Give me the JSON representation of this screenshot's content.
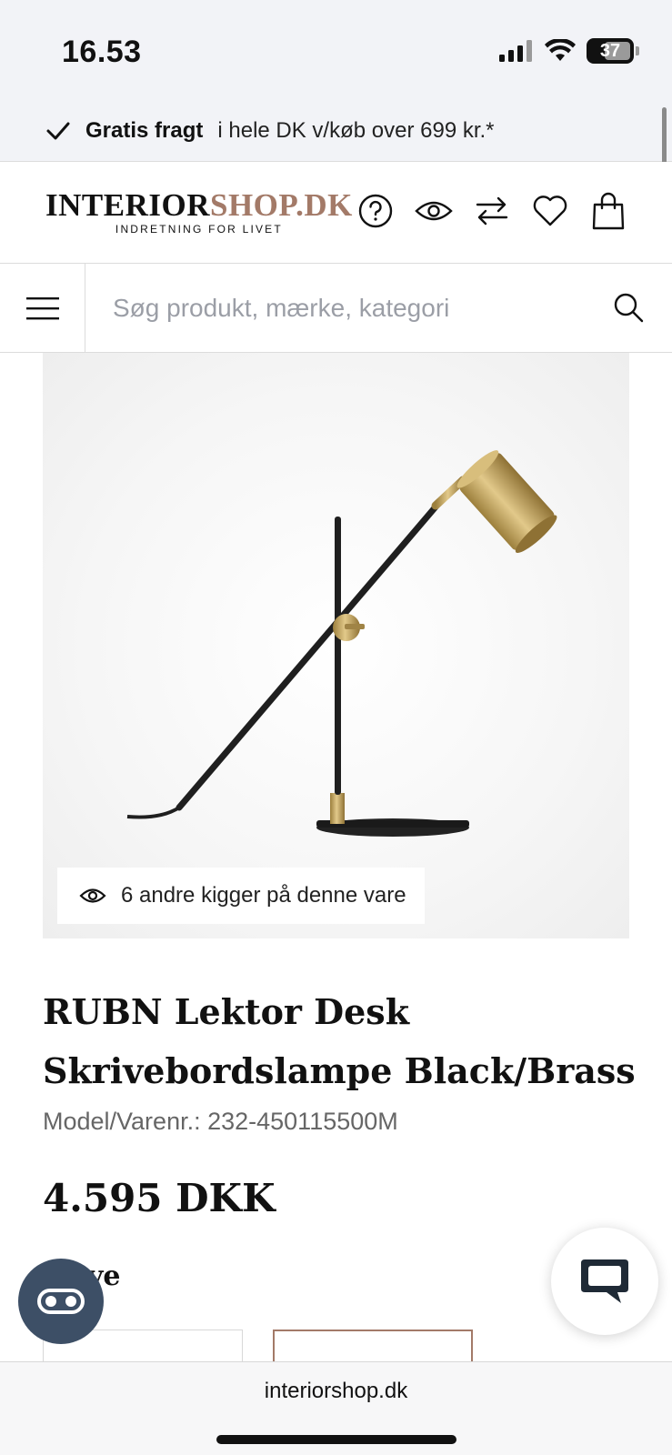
{
  "status_bar": {
    "time": "16.53",
    "battery": "37"
  },
  "promo": {
    "bold": "Gratis fragt",
    "text": "i hele DK v/køb over 699 kr.*"
  },
  "header": {
    "logo_part1": "INTERIOR",
    "logo_part2": "SHOP.DK",
    "logo_tagline": "INDRETNING FOR LIVET",
    "icons": [
      "help-icon",
      "eye-icon",
      "compare-icon",
      "heart-icon",
      "shopping-bag-icon"
    ]
  },
  "search": {
    "placeholder": "Søg produkt, mærke, kategori"
  },
  "product": {
    "viewers_text": "6 andre kigger på denne vare",
    "title": "RUBN Lektor Desk Skrivebordslampe Black/Brass",
    "model": "Model/Varenr.: 232-450115500M",
    "price": "4.595 DKK",
    "section_label_partial": "ve"
  },
  "browser": {
    "url": "interiorshop.dk"
  },
  "colors": {
    "accent": "#a37a68",
    "a11y_button": "#3d4f66",
    "promo_bg": "#f2f3f7",
    "lamp_brass": "#c9a85c",
    "lamp_black": "#1f1f1f"
  }
}
